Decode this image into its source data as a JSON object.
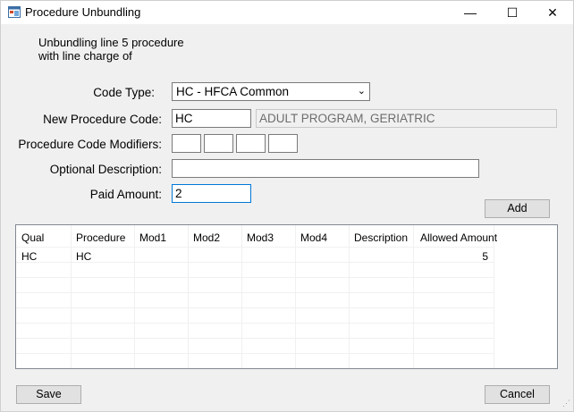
{
  "window": {
    "title": "Procedure Unbundling",
    "minimize": "—",
    "maximize": "☐",
    "close": "✕"
  },
  "intro": {
    "line1": "Unbundling line 5 procedure",
    "line2": "with line charge of"
  },
  "form": {
    "code_type_label": "Code Type:",
    "code_type_value": "HC - HFCA Common",
    "new_code_label": "New Procedure Code:",
    "new_code_value": "HC",
    "new_code_desc": "ADULT PROGRAM, GERIATRIC",
    "modifiers_label": "Procedure Code Modifiers:",
    "modifiers": [
      "",
      "",
      "",
      ""
    ],
    "optional_desc_label": "Optional Description:",
    "optional_desc_value": "",
    "paid_amount_label": "Paid Amount:",
    "paid_amount_value": "2"
  },
  "buttons": {
    "add": "Add",
    "save": "Save",
    "cancel": "Cancel"
  },
  "grid": {
    "columns": [
      "Qual",
      "Procedure",
      "Mod1",
      "Mod2",
      "Mod3",
      "Mod4",
      "Description",
      "Allowed Amount"
    ],
    "rows": [
      [
        "HC",
        "HC",
        "",
        "",
        "",
        "",
        "",
        "5"
      ]
    ]
  }
}
